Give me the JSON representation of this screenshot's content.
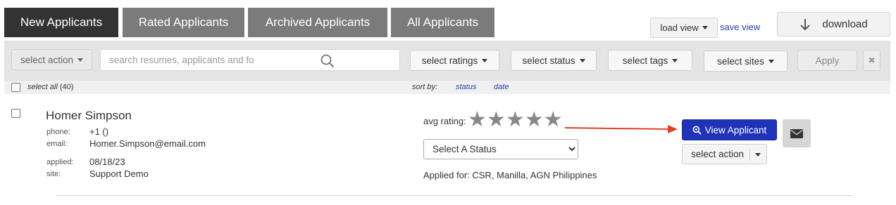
{
  "tabs": [
    {
      "label": "New Applicants",
      "active": true
    },
    {
      "label": "Rated Applicants",
      "active": false
    },
    {
      "label": "Archived Applicants",
      "active": false
    },
    {
      "label": "All Applicants",
      "active": false
    }
  ],
  "toolbar": {
    "load_view": "load view",
    "save_view": "save view",
    "download": "download"
  },
  "filters": {
    "select_action": "select action",
    "search_placeholder": "search resumes, applicants and fo",
    "select_ratings": "select ratings",
    "select_status": "select status",
    "select_tags": "select tags",
    "select_sites": "select sites",
    "apply": "Apply",
    "clear": "✖"
  },
  "list_header": {
    "select_all": "select all",
    "count": "(40)",
    "sort_by": "sort by:",
    "sort_status": "status",
    "sort_date": "date"
  },
  "applicant": {
    "name": "Homer Simpson",
    "phone_label": "phone:",
    "phone": "+1 ()",
    "email_label": "email:",
    "email": "Homer.Simpson@email.com",
    "applied_label": "applied:",
    "applied": "08/18/23",
    "site_label": "site:",
    "site": "Support Demo",
    "avg_rating_label": "avg rating:",
    "rating_stars": 5,
    "rating_value": 0,
    "status_selected": "Select A Status",
    "applied_for": "Applied for: CSR, Manilla, AGN Philippines",
    "view_button": "View Applicant",
    "action_select": "select action"
  },
  "colors": {
    "tab_active": "#333333",
    "tab_inactive": "#7b7b7b",
    "primary_button": "#2033b8",
    "link": "#2a3fa8",
    "annotation_arrow": "#e0402a"
  },
  "icons": [
    "search-icon",
    "download-arrow-icon",
    "zoom-icon",
    "mail-icon",
    "star-icon",
    "caret-down-icon",
    "close-icon"
  ]
}
